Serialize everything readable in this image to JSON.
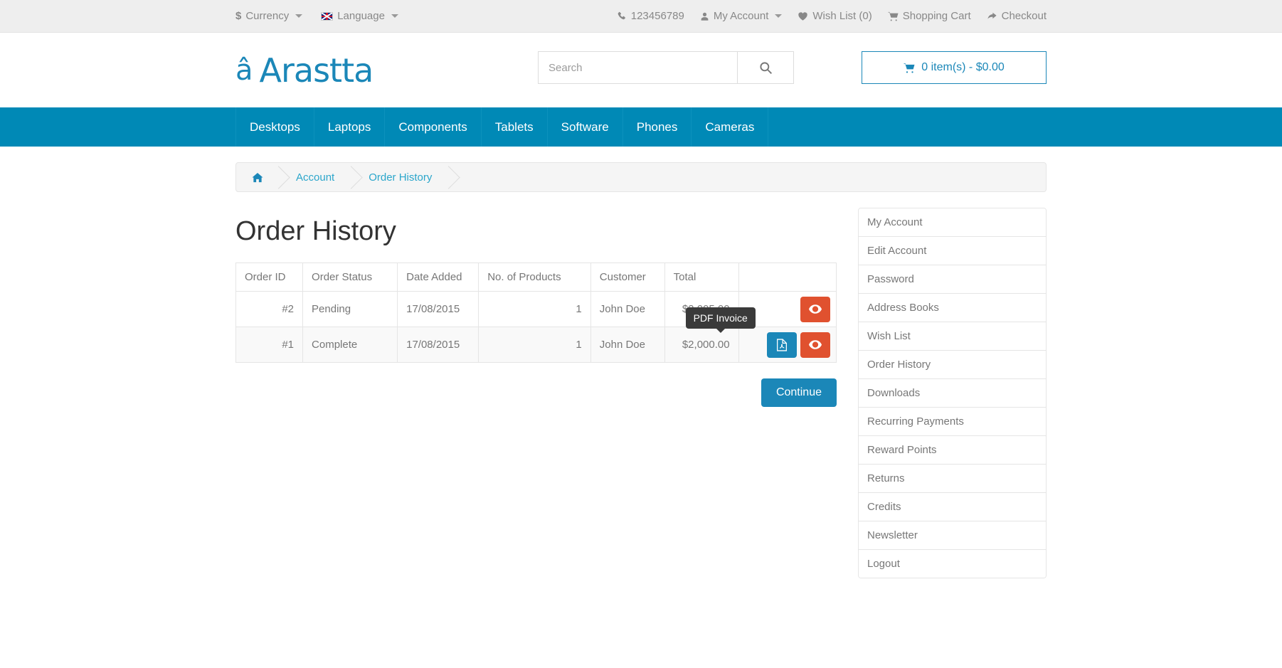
{
  "topbar": {
    "currency": {
      "symbol": "$",
      "label": "Currency"
    },
    "language": {
      "label": "Language"
    },
    "phone": "123456789",
    "my_account": "My Account",
    "wish_list": "Wish List (0)",
    "shopping_cart": "Shopping Cart",
    "checkout": "Checkout"
  },
  "header": {
    "logo_text": "Arastta",
    "logo_mark": "â",
    "search_placeholder": "Search",
    "search_value": "",
    "cart_label": "0 item(s) - $0.00"
  },
  "nav": {
    "items": [
      {
        "label": "Desktops"
      },
      {
        "label": "Laptops"
      },
      {
        "label": "Components"
      },
      {
        "label": "Tablets"
      },
      {
        "label": "Software"
      },
      {
        "label": "Phones"
      },
      {
        "label": "Cameras"
      }
    ]
  },
  "breadcrumb": {
    "home": "Home",
    "items": [
      {
        "label": "Account"
      },
      {
        "label": "Order History"
      }
    ]
  },
  "main": {
    "page_title": "Order History",
    "table": {
      "columns": [
        "Order ID",
        "Order Status",
        "Date Added",
        "No. of Products",
        "Customer",
        "Total",
        ""
      ],
      "rows": [
        {
          "order_id": "#2",
          "order_status": "Pending",
          "date_added": "17/08/2015",
          "products": "1",
          "customer": "John Doe",
          "total": "$2,005.00",
          "has_pdf": false,
          "view_label": "View"
        },
        {
          "order_id": "#1",
          "order_status": "Complete",
          "date_added": "17/08/2015",
          "products": "1",
          "customer": "John Doe",
          "total": "$2,000.00",
          "has_pdf": true,
          "view_label": "View",
          "pdf_label": "PDF Invoice"
        }
      ]
    },
    "tooltip": "PDF Invoice",
    "continue_label": "Continue"
  },
  "sidebar": {
    "items": [
      {
        "label": "My Account"
      },
      {
        "label": "Edit Account"
      },
      {
        "label": "Password"
      },
      {
        "label": "Address Books"
      },
      {
        "label": "Wish List"
      },
      {
        "label": "Order History"
      },
      {
        "label": "Downloads"
      },
      {
        "label": "Recurring Payments"
      },
      {
        "label": "Reward Points"
      },
      {
        "label": "Returns"
      },
      {
        "label": "Credits"
      },
      {
        "label": "Newsletter"
      },
      {
        "label": "Logout"
      }
    ]
  },
  "colors": {
    "brand": "#0089b6",
    "link": "#2ba6cb",
    "danger": "#e0512f",
    "primary": "#1b87b8",
    "tooltip_bg": "#3a3a3a"
  }
}
